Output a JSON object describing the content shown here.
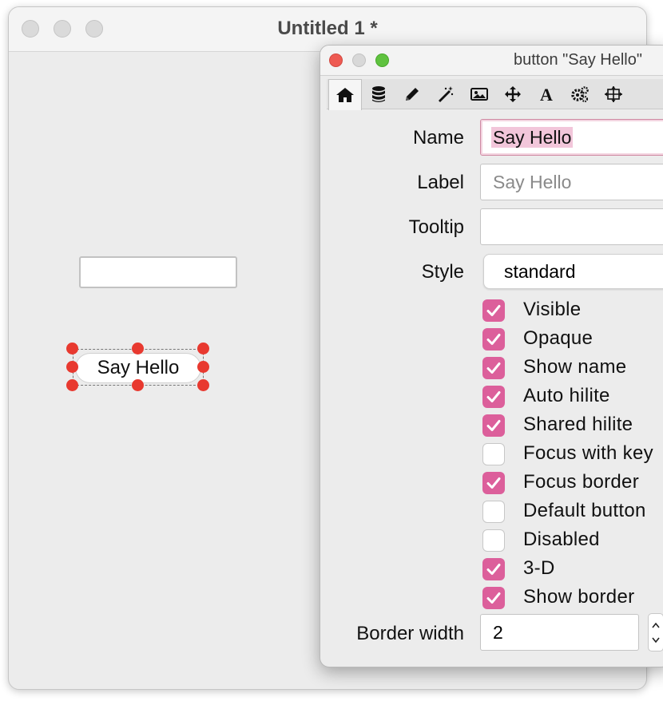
{
  "main_window": {
    "title": "Untitled 1 *",
    "canvas": {
      "button_label": "Say Hello",
      "field_value": ""
    }
  },
  "inspector": {
    "title": "button \"Say Hello\"",
    "toolbar": [
      {
        "icon": "home-icon",
        "active": true
      },
      {
        "icon": "database-icon"
      },
      {
        "icon": "pencil-icon"
      },
      {
        "icon": "magic-wand-icon"
      },
      {
        "icon": "image-icon"
      },
      {
        "icon": "move-icon"
      },
      {
        "icon": "text-icon"
      },
      {
        "icon": "gears-icon"
      },
      {
        "icon": "resize-icon"
      }
    ],
    "name": {
      "label": "Name",
      "value": "Say Hello"
    },
    "label_field": {
      "label": "Label",
      "placeholder": "Say Hello"
    },
    "tooltip": {
      "label": "Tooltip",
      "value": ""
    },
    "style": {
      "label": "Style",
      "value": "standard"
    },
    "checkboxes": [
      {
        "label": "Visible",
        "checked": true
      },
      {
        "label": "Opaque",
        "checked": true
      },
      {
        "label": "Show name",
        "checked": true
      },
      {
        "label": "Auto hilite",
        "checked": true
      },
      {
        "label": "Shared hilite",
        "checked": true
      },
      {
        "label": "Focus with key",
        "checked": false
      },
      {
        "label": "Focus border",
        "checked": true
      },
      {
        "label": "Default button",
        "checked": false
      },
      {
        "label": "Disabled",
        "checked": false
      },
      {
        "label": "3-D",
        "checked": true
      },
      {
        "label": "Show border",
        "checked": true
      }
    ],
    "border_width": {
      "label": "Border width",
      "value": "2"
    }
  },
  "colors": {
    "accent_pink": "#dc5f9b",
    "handle_red": "#e8392f",
    "close": "#ee5a52",
    "minimize": "#d8d8d8",
    "zoom": "#5fc23f"
  }
}
